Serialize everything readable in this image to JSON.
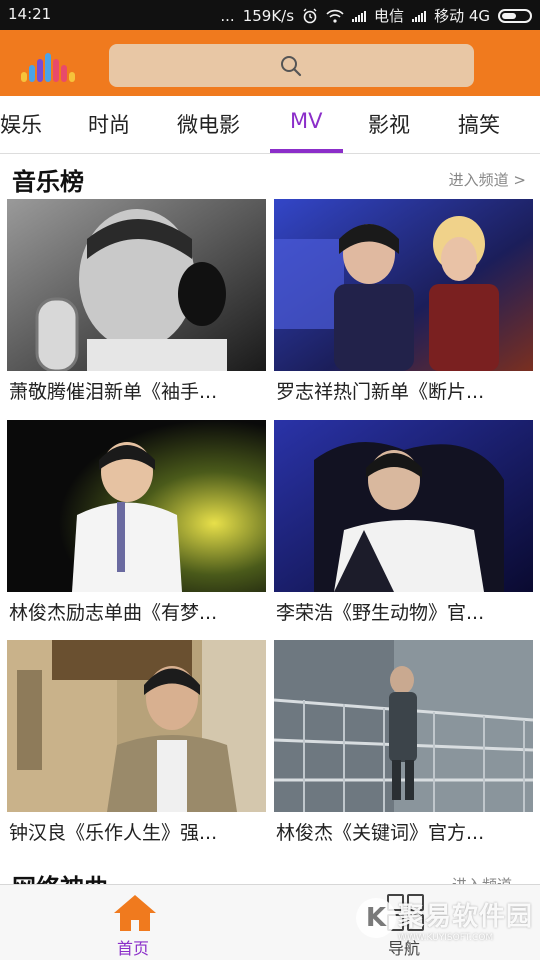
{
  "status_bar": {
    "time": "14:21",
    "dots": "...",
    "speed": "159K/s",
    "carrier1": "电信",
    "carrier2": "移动 4G"
  },
  "header": {
    "logo": "music-bars-logo",
    "search_icon": "search-icon",
    "brand_color": "#f07a1e"
  },
  "tabs": {
    "items": [
      "娱乐",
      "时尚",
      "微电影",
      "MV",
      "影视",
      "搞笑"
    ],
    "active_index": 3,
    "active_color": "#8b2ec9"
  },
  "section1": {
    "title": "音乐榜",
    "link": "进入频道 >"
  },
  "videos": [
    {
      "title": "萧敬腾催泪新单《袖手..."
    },
    {
      "title": "罗志祥热门新单《断片..."
    },
    {
      "title": "林俊杰励志单曲《有梦..."
    },
    {
      "title": "李荣浩《野生动物》官..."
    },
    {
      "title": "钟汉良《乐作人生》强..."
    },
    {
      "title": "林俊杰《关键词》官方..."
    }
  ],
  "section2": {
    "title": "网络神曲",
    "link": "进入频道"
  },
  "bottom_nav": {
    "home_label": "首页",
    "guide_label": "导航"
  },
  "watermark": {
    "logo_letter": "K",
    "text": "聚易软件园",
    "url": "WWW.KUYISOFT.COM"
  }
}
